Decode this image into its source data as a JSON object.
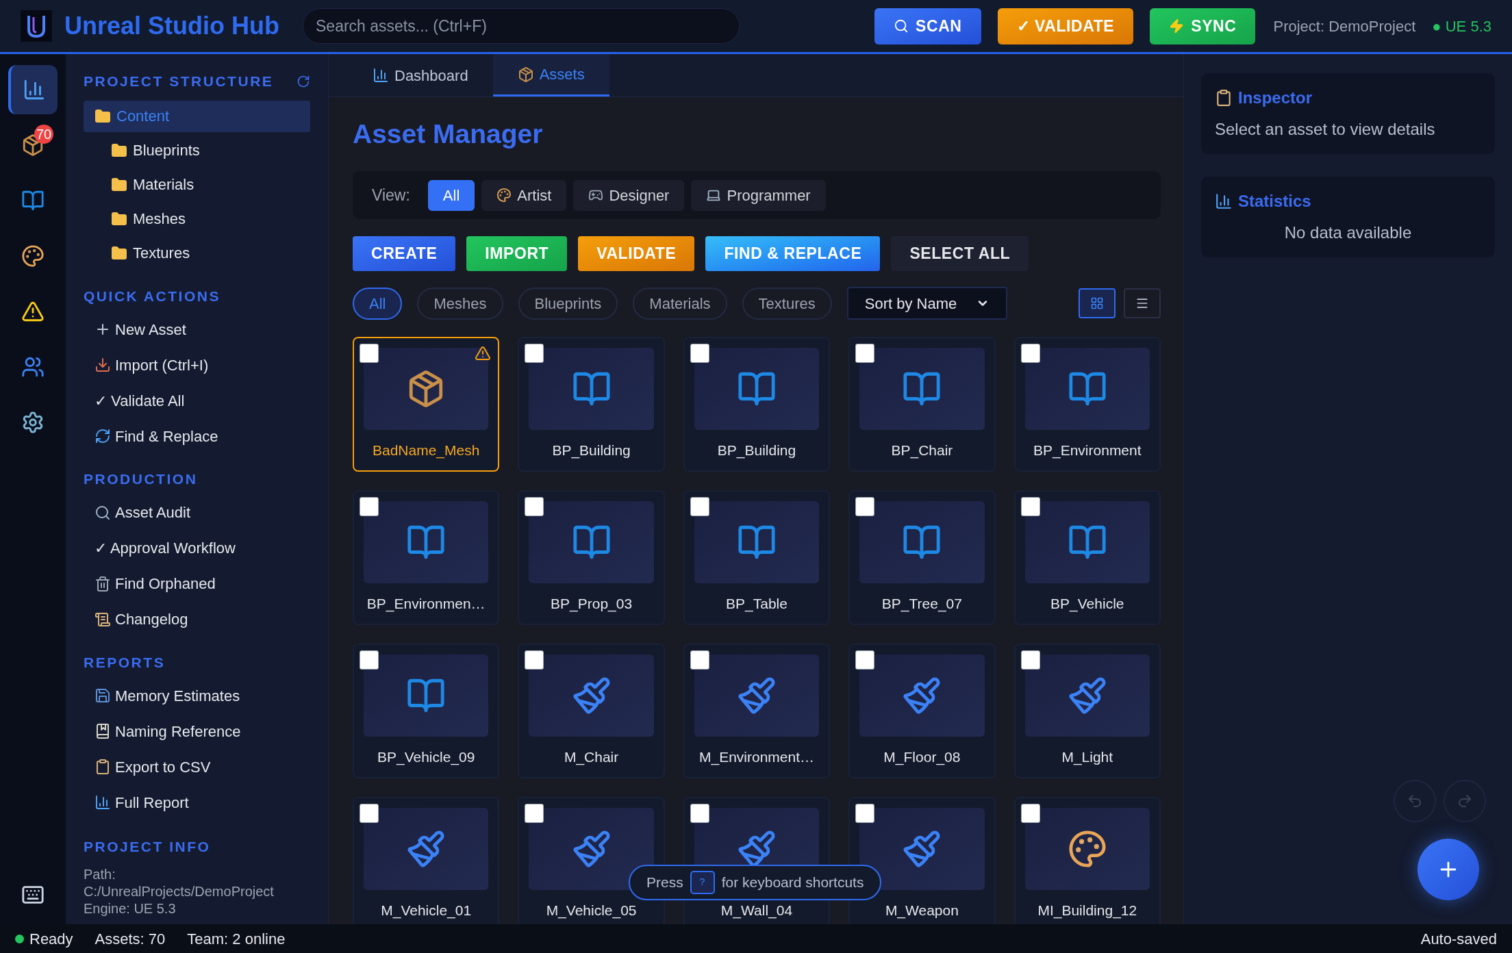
{
  "header": {
    "title": "Unreal Studio Hub",
    "search": {
      "placeholder": "Search assets... (Ctrl+F)"
    },
    "buttons": [
      {
        "label": "SCAN",
        "kind": "primary"
      },
      {
        "label": "✓ VALIDATE",
        "kind": "warning"
      },
      {
        "label": "SYNC",
        "kind": "success"
      }
    ],
    "project": "Project: DemoProject",
    "engine": "● UE 5.3"
  },
  "rail": [
    {
      "selected": true
    },
    {
      "selected": false,
      "badge": "70"
    },
    {
      "selected": false
    },
    {
      "selected": false
    },
    {
      "selected": false
    },
    {
      "selected": false
    },
    {
      "selected": false
    }
  ],
  "sidebar": {
    "structure": {
      "title": "PROJECT STRUCTURE",
      "tree": [
        {
          "label": "Content",
          "selected": true,
          "children": [
            {
              "label": "Blueprints",
              "selected": false
            },
            {
              "label": "Materials",
              "selected": false
            },
            {
              "label": "Meshes",
              "selected": false
            },
            {
              "label": "Textures",
              "selected": false
            }
          ]
        }
      ]
    },
    "sections": [
      {
        "title": "QUICK ACTIONS",
        "items": [
          "New Asset",
          "Import (Ctrl+I)",
          "✓ Validate All",
          "Find & Replace"
        ]
      },
      {
        "title": "PRODUCTION",
        "items": [
          "Asset Audit",
          "✓ Approval Workflow",
          "Find Orphaned",
          "Changelog"
        ]
      },
      {
        "title": "REPORTS",
        "items": [
          "Memory Estimates",
          "Naming Reference",
          "Export to CSV",
          "Full Report"
        ]
      }
    ],
    "project_info": {
      "title": "PROJECT INFO",
      "lines": [
        "Path:",
        "C:/UnrealProjects/DemoProject",
        "Engine: UE 5.3"
      ]
    }
  },
  "tabs": [
    {
      "label": "Dashboard",
      "selected": false
    },
    {
      "label": "Assets",
      "selected": true
    }
  ],
  "main": {
    "title": "Asset Manager",
    "view": {
      "label": "View:",
      "options": [
        {
          "label": "All",
          "selected": true
        },
        {
          "label": "Artist",
          "selected": false
        },
        {
          "label": "Designer",
          "selected": false
        },
        {
          "label": "Programmer",
          "selected": false
        }
      ]
    },
    "actions": [
      {
        "label": "CREATE",
        "kind": "primary"
      },
      {
        "label": "IMPORT",
        "kind": "success"
      },
      {
        "label": "VALIDATE",
        "kind": "warning"
      },
      {
        "label": "FIND & REPLACE",
        "kind": "info"
      },
      {
        "label": "SELECT ALL",
        "kind": "neutral"
      }
    ],
    "filters": [
      {
        "label": "All",
        "selected": true
      },
      {
        "label": "Meshes",
        "selected": false
      },
      {
        "label": "Blueprints",
        "selected": false
      },
      {
        "label": "Materials",
        "selected": false
      },
      {
        "label": "Textures",
        "selected": false
      }
    ],
    "sort": "Sort by Name",
    "view_modes": [
      {
        "kind": "grid",
        "selected": true
      },
      {
        "kind": "list",
        "selected": false
      }
    ],
    "assets": [
      {
        "name": "BadName_Mesh",
        "kind": "mesh",
        "warning": true,
        "checked": false
      },
      {
        "name": "BP_Building",
        "kind": "blueprint",
        "warning": false,
        "checked": false
      },
      {
        "name": "BP_Building",
        "kind": "blueprint",
        "warning": false,
        "checked": false
      },
      {
        "name": "BP_Chair",
        "kind": "blueprint",
        "warning": false,
        "checked": false
      },
      {
        "name": "BP_Environment",
        "kind": "blueprint",
        "warning": false,
        "checked": false
      },
      {
        "name": "BP_Environmen…",
        "kind": "blueprint",
        "warning": false,
        "checked": false
      },
      {
        "name": "BP_Prop_03",
        "kind": "blueprint",
        "warning": false,
        "checked": false
      },
      {
        "name": "BP_Table",
        "kind": "blueprint",
        "warning": false,
        "checked": false
      },
      {
        "name": "BP_Tree_07",
        "kind": "blueprint",
        "warning": false,
        "checked": false
      },
      {
        "name": "BP_Vehicle",
        "kind": "blueprint",
        "warning": false,
        "checked": false
      },
      {
        "name": "BP_Vehicle_09",
        "kind": "blueprint",
        "warning": false,
        "checked": false
      },
      {
        "name": "M_Chair",
        "kind": "material",
        "warning": false,
        "checked": false
      },
      {
        "name": "M_Environment…",
        "kind": "material",
        "warning": false,
        "checked": false
      },
      {
        "name": "M_Floor_08",
        "kind": "material",
        "warning": false,
        "checked": false
      },
      {
        "name": "M_Light",
        "kind": "material",
        "warning": false,
        "checked": false
      },
      {
        "name": "M_Vehicle_01",
        "kind": "material",
        "warning": false,
        "checked": false
      },
      {
        "name": "M_Vehicle_05",
        "kind": "material",
        "warning": false,
        "checked": false
      },
      {
        "name": "M_Wall_04",
        "kind": "material",
        "warning": false,
        "checked": false
      },
      {
        "name": "M_Weapon",
        "kind": "material",
        "warning": false,
        "checked": false
      },
      {
        "name": "MI_Building_12",
        "kind": "instance",
        "warning": false,
        "checked": false
      }
    ],
    "hint": {
      "before": "Press",
      "key": "?",
      "after": "for keyboard shortcuts"
    }
  },
  "inspector": {
    "title": "Inspector",
    "text": "Select an asset to view details"
  },
  "statistics": {
    "title": "Statistics",
    "text": "No data available"
  },
  "status_bar": {
    "ready": "Ready",
    "assets": "Assets: 70",
    "team": "Team: 2 online",
    "saved": "Auto-saved"
  }
}
